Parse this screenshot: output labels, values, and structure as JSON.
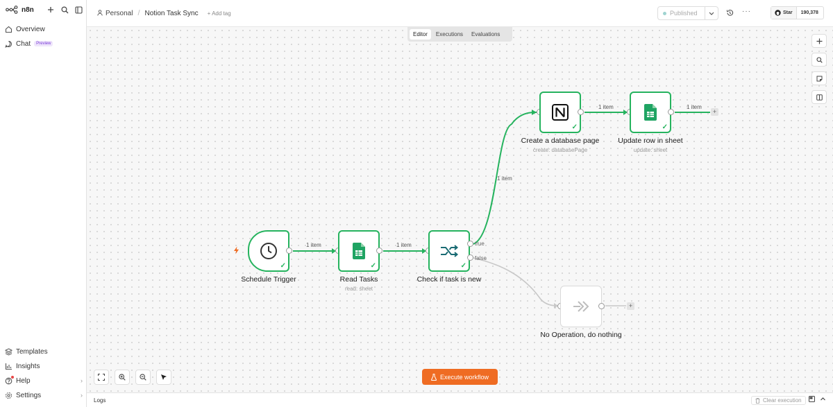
{
  "sidebar": {
    "brand": "n8n",
    "top_items": [
      {
        "label": "Overview",
        "icon": "home-icon"
      },
      {
        "label": "Chat",
        "icon": "chat-icon",
        "badge": "Preview"
      }
    ],
    "bottom_items": [
      {
        "label": "Templates",
        "icon": "templates-icon"
      },
      {
        "label": "Insights",
        "icon": "insights-icon"
      },
      {
        "label": "Help",
        "icon": "help-icon"
      },
      {
        "label": "Settings",
        "icon": "settings-icon"
      }
    ]
  },
  "header": {
    "project": "Personal",
    "workflow_name": "Notion Task Sync",
    "add_tag": "+ Add tag",
    "publish_label": "Published",
    "github_star": "Star",
    "github_count": "190,378"
  },
  "tabs": [
    "Editor",
    "Executions",
    "Evaluations"
  ],
  "nodes": {
    "schedule": {
      "title": "Schedule Trigger"
    },
    "read": {
      "title": "Read Tasks",
      "subtitle": "read: sheet"
    },
    "check": {
      "title": "Check if task is new"
    },
    "create": {
      "title": "Create a database page",
      "subtitle": "create: databasePage"
    },
    "update": {
      "title": "Update row in sheet",
      "subtitle": "update: sheet"
    },
    "noop": {
      "title": "No Operation, do nothing"
    }
  },
  "edges": {
    "item_label": "1 item",
    "true_label": "true",
    "false_label": "false"
  },
  "footer": {
    "execute_label": "Execute workflow",
    "logs_label": "Logs",
    "clear_label": "Clear execution"
  },
  "colors": {
    "success": "#25b35e",
    "accent": "#ef6c23",
    "sheets": "#1fa463"
  }
}
